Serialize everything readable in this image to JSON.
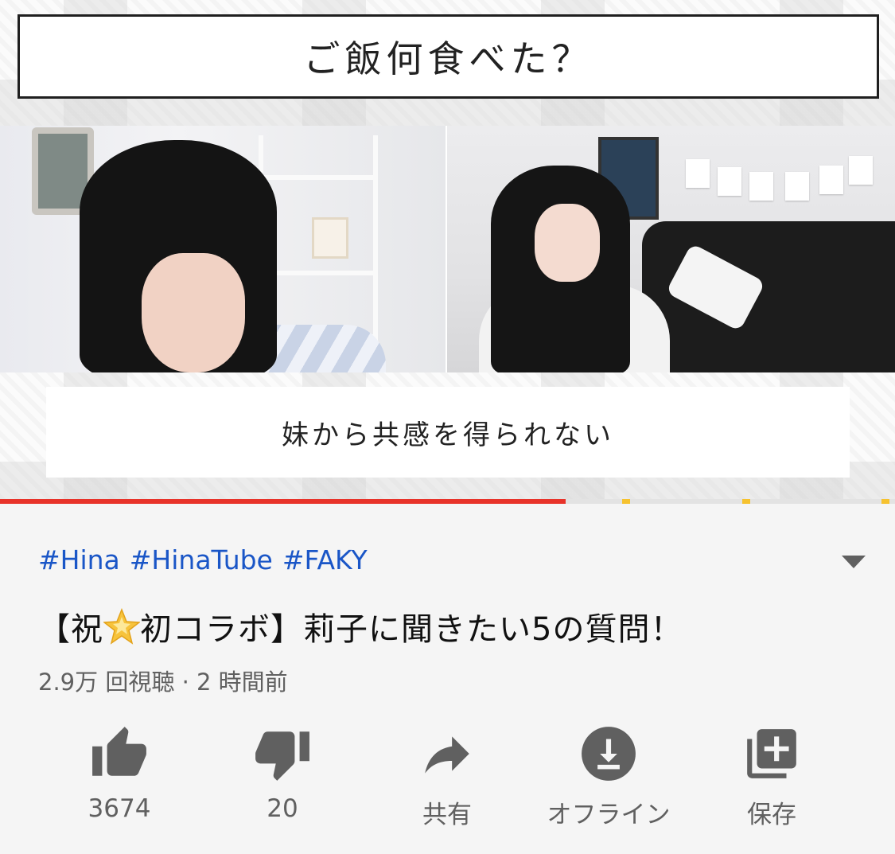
{
  "video": {
    "title_card": "ご飯何食べた？",
    "subtitle": "妹から共感を得られない",
    "progress": 0.632
  },
  "info": {
    "hashtags": [
      "#Hina",
      "#HinaTube",
      "#FAKY"
    ],
    "title_before_emoji": "【祝",
    "title_after_emoji": "初コラボ】莉子に聞きたい5の質問！",
    "views": "2.9万 回視聴",
    "separator": "·",
    "time_ago": "2 時間前"
  },
  "actions": {
    "like_count": "3674",
    "dislike_count": "20",
    "share_label": "共有",
    "offline_label": "オフライン",
    "save_label": "保存"
  },
  "colors": {
    "progress": "#e8332a",
    "hashtag": "#1a56c7",
    "icon": "#606060",
    "ad_marker": "#f6c22f"
  },
  "icons": [
    "expand-arrow-icon",
    "star-emoji-icon",
    "like-icon",
    "dislike-icon",
    "share-icon",
    "download-icon",
    "playlist-add-icon"
  ]
}
